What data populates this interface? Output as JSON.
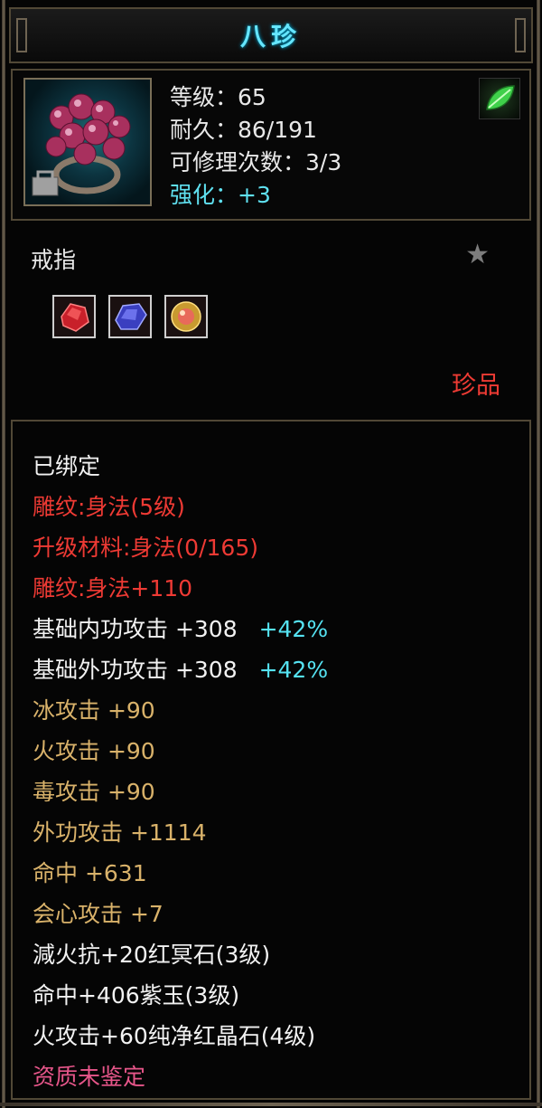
{
  "item": {
    "name": "八珍",
    "level_line": "等级：65",
    "durability_line": "耐久：86/191",
    "repair_line": "可修理次数：3/3",
    "enhance_line": "强化：+3",
    "type": "戒指",
    "quality": "珍品"
  },
  "gems": [
    "red-gem-icon",
    "blue-gem-icon",
    "gold-gem-icon"
  ],
  "attributes": [
    {
      "text": "已绑定",
      "extra": "",
      "color": "white"
    },
    {
      "text": "雕纹:身法(5级)",
      "extra": "",
      "color": "red"
    },
    {
      "text": "升级材料:身法(0/165)",
      "extra": "",
      "color": "red"
    },
    {
      "text": "雕纹:身法+110",
      "extra": "",
      "color": "red"
    },
    {
      "text": "基础内功攻击  +308",
      "extra": "+42%",
      "color": "white"
    },
    {
      "text": "基础外功攻击  +308",
      "extra": "+42%",
      "color": "white"
    },
    {
      "text": "冰攻击  +90",
      "extra": "",
      "color": "gold"
    },
    {
      "text": "火攻击  +90",
      "extra": "",
      "color": "gold"
    },
    {
      "text": "毒攻击  +90",
      "extra": "",
      "color": "gold"
    },
    {
      "text": "外功攻击  +1114",
      "extra": "",
      "color": "gold"
    },
    {
      "text": "命中  +631",
      "extra": "",
      "color": "gold"
    },
    {
      "text": "会心攻击  +7",
      "extra": "",
      "color": "gold"
    },
    {
      "text": "減火抗+20红冥石(3级)",
      "extra": "",
      "color": "white"
    },
    {
      "text": "命中+406紫玉(3级)",
      "extra": "",
      "color": "white"
    },
    {
      "text": "火攻击+60纯净红晶石(4级)",
      "extra": "",
      "color": "white"
    },
    {
      "text": "资质未鉴定",
      "extra": "",
      "color": "pink"
    }
  ],
  "colors": {
    "title": "#66e6ff",
    "white": "#f2f2f2",
    "red": "#ee3a34",
    "gold": "#d9b26a",
    "pink": "#e7568a",
    "percent": "#55e3f2",
    "border": "#514836"
  }
}
